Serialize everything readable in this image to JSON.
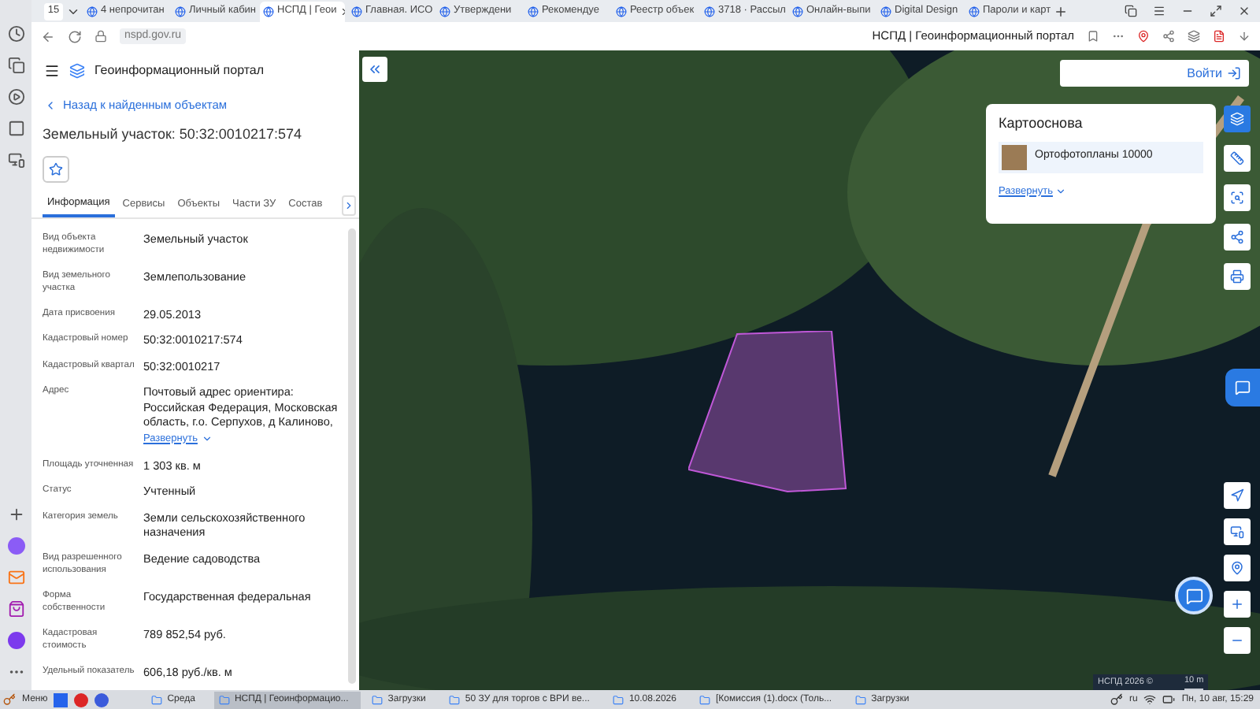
{
  "browser": {
    "tab_count": "15",
    "tabs": [
      {
        "label": "4 непрочитан",
        "selected": false
      },
      {
        "label": "Личный кабин",
        "selected": false
      },
      {
        "label": "НСПД | Геои",
        "selected": true
      },
      {
        "label": "Главная. ИСО",
        "selected": false
      },
      {
        "label": "Утверждени",
        "selected": false
      },
      {
        "label": "Рекомендуе",
        "selected": false
      },
      {
        "label": "Реестр объек",
        "selected": false
      },
      {
        "label": "3718 · Рассыл",
        "selected": false
      },
      {
        "label": "Онлайн-выпи",
        "selected": false
      },
      {
        "label": "Digital Design",
        "selected": false
      },
      {
        "label": "Пароли и карт",
        "selected": false
      }
    ],
    "url": "nspd.gov.ru",
    "page_title": "НСПД | Геоинформационный портал"
  },
  "panel": {
    "app_title": "Геоинформационный портал",
    "back_link": "Назад к найденным объектам",
    "title": "Земельный участок: 50:32:0010217:574",
    "tabs": [
      {
        "label": "Информация",
        "selected": true
      },
      {
        "label": "Сервисы",
        "selected": false
      },
      {
        "label": "Объекты",
        "selected": false
      },
      {
        "label": "Части ЗУ",
        "selected": false
      },
      {
        "label": "Состав",
        "selected": false
      }
    ],
    "fields": [
      {
        "label": "Вид объекта недвижимости",
        "value": "Земельный участок"
      },
      {
        "label": "Вид земельного участка",
        "value": "Землепользование"
      },
      {
        "label": "Дата присвоения",
        "value": "29.05.2013"
      },
      {
        "label": "Кадастровый номер",
        "value": "50:32:0010217:574"
      },
      {
        "label": "Кадастровый квартал",
        "value": "50:32:0010217"
      },
      {
        "label": "Адрес",
        "value": "Почтовый адрес ориентира: Российская Федерация, Московская область, г.о. Серпухов, д Калиново,",
        "link": "Развернуть"
      },
      {
        "label": "Площадь уточненная",
        "value": "1 303 кв. м"
      },
      {
        "label": "Статус",
        "value": "Учтенный"
      },
      {
        "label": "Категория земель",
        "value": "Земли сельскохозяйственного назначения"
      },
      {
        "label": "Вид разрешенного использования",
        "value": "Ведение садоводства"
      },
      {
        "label": "Форма собственности",
        "value": "Государственная федеральная"
      },
      {
        "label": "Кадастровая стоимость",
        "value": "789 852,54 руб."
      },
      {
        "label": "Удельный показатель",
        "value": "606,18 руб./кв. м"
      }
    ]
  },
  "map": {
    "login": "Войти",
    "basemap": {
      "title": "Картооснова",
      "layer": "Ортофотопланы 10000",
      "expand": "Развернуть"
    },
    "attribution": "НСПД 2026 ©",
    "scale": "10 m"
  },
  "taskbar": {
    "menu": "Меню",
    "items": [
      {
        "label": "Среда",
        "selected": false
      },
      {
        "label": "НСПД | Геоинформацио...",
        "selected": true
      },
      {
        "label": "Загрузки",
        "selected": false
      },
      {
        "label": "50 ЗУ для торгов с ВРИ ве...",
        "selected": false
      },
      {
        "label": "10.08.2026",
        "selected": false
      },
      {
        "label": "[Комиссия (1).docx (Толь...",
        "selected": false
      },
      {
        "label": "Загрузки",
        "selected": false
      }
    ],
    "lang": "ru",
    "clock": "Пн, 10 авг, 15:29"
  }
}
